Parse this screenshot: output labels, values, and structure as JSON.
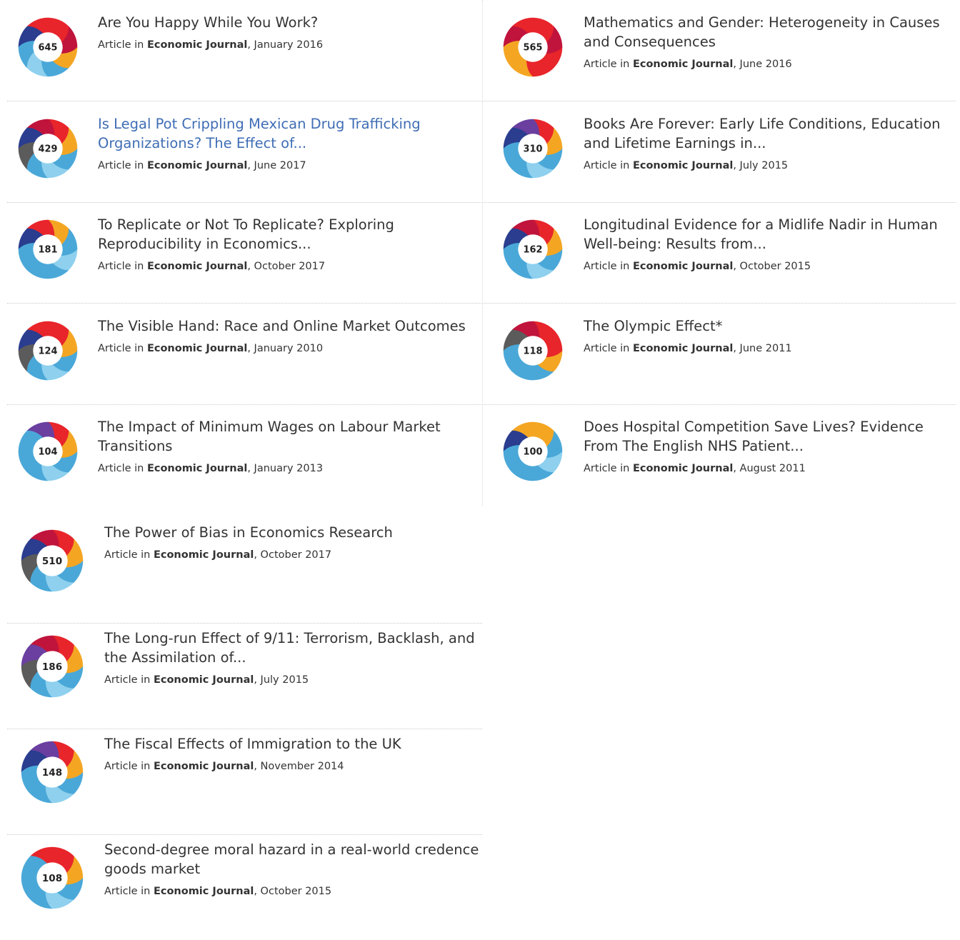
{
  "donut_colors": [
    "#e8252b",
    "#f4a623",
    "#4aa8d8",
    "#8ed0ee",
    "#2a3d8f",
    "#6a3fa0",
    "#5b5b5b",
    "#c0143c"
  ],
  "articles": [
    {
      "score": "645",
      "title": "Are You Happy While You Work?",
      "prefix": "Article in ",
      "journal": "Economic Journal",
      "date": ", January 2016",
      "link": false,
      "colors": [
        "#e8252b",
        "#c0143c",
        "#f4a623",
        "#4aa8d8",
        "#8ed0ee",
        "#4aa8d8",
        "#2a3d8f",
        "#e8252b"
      ]
    },
    {
      "score": "565",
      "title": "Mathematics and Gender: Heterogeneity in Causes and Consequences",
      "prefix": "Article in ",
      "journal": "Economic Journal",
      "date": ", June 2016",
      "link": false,
      "colors": [
        "#e8252b",
        "#c0143c",
        "#e8252b",
        "#e8252b",
        "#f4a623",
        "#f4a623",
        "#c0143c",
        "#e8252b"
      ]
    },
    {
      "score": "429",
      "title": "Is Legal Pot Crippling Mexican Drug Trafficking Organizations? The Effect of...",
      "prefix": "Article in ",
      "journal": "Economic Journal",
      "date": ", June 2017",
      "link": true,
      "colors": [
        "#e8252b",
        "#f4a623",
        "#4aa8d8",
        "#8ed0ee",
        "#4aa8d8",
        "#5b5b5b",
        "#2a3d8f",
        "#c0143c"
      ]
    },
    {
      "score": "310",
      "title": "Books Are Forever: Early Life Conditions, Education and Lifetime Earnings in...",
      "prefix": "Article in ",
      "journal": "Economic Journal",
      "date": ", July 2015",
      "link": false,
      "colors": [
        "#e8252b",
        "#f4a623",
        "#4aa8d8",
        "#8ed0ee",
        "#4aa8d8",
        "#4aa8d8",
        "#2a3d8f",
        "#6a3fa0"
      ]
    },
    {
      "score": "181",
      "title": "To Replicate or Not To Replicate? Exploring Reproducibility in Economics...",
      "prefix": "Article in ",
      "journal": "Economic Journal",
      "date": ", October 2017",
      "link": false,
      "colors": [
        "#f4a623",
        "#4aa8d8",
        "#8ed0ee",
        "#4aa8d8",
        "#4aa8d8",
        "#4aa8d8",
        "#2a3d8f",
        "#e8252b"
      ]
    },
    {
      "score": "162",
      "title": "Longitudinal Evidence for a Midlife Nadir in Human Well-being: Results from...",
      "prefix": "Article in ",
      "journal": "Economic Journal",
      "date": ", October 2015",
      "link": false,
      "colors": [
        "#e8252b",
        "#f4a623",
        "#4aa8d8",
        "#8ed0ee",
        "#4aa8d8",
        "#4aa8d8",
        "#2a3d8f",
        "#c0143c"
      ]
    },
    {
      "score": "124",
      "title": "The Visible Hand: Race and Online Market Outcomes",
      "prefix": "Article in ",
      "journal": "Economic Journal",
      "date": ", January 2010",
      "link": false,
      "colors": [
        "#e8252b",
        "#f4a623",
        "#4aa8d8",
        "#8ed0ee",
        "#4aa8d8",
        "#5b5b5b",
        "#2a3d8f",
        "#e8252b"
      ]
    },
    {
      "score": "118",
      "title": "The Olympic Effect*",
      "prefix": "Article in ",
      "journal": "Economic Journal",
      "date": ", June 2011",
      "link": false,
      "colors": [
        "#e8252b",
        "#e8252b",
        "#f4a623",
        "#4aa8d8",
        "#4aa8d8",
        "#4aa8d8",
        "#5b5b5b",
        "#c0143c"
      ]
    },
    {
      "score": "104",
      "title": "The Impact of Minimum Wages on Labour Market Transitions",
      "prefix": "Article in ",
      "journal": "Economic Journal",
      "date": ", January 2013",
      "link": false,
      "colors": [
        "#e8252b",
        "#f4a623",
        "#4aa8d8",
        "#8ed0ee",
        "#4aa8d8",
        "#4aa8d8",
        "#4aa8d8",
        "#6a3fa0"
      ]
    },
    {
      "score": "100",
      "title": "Does Hospital Competition Save Lives? Evidence From The English NHS Patient...",
      "prefix": "Article in ",
      "journal": "Economic Journal",
      "date": ", August 2011",
      "link": false,
      "colors": [
        "#f4a623",
        "#4aa8d8",
        "#8ed0ee",
        "#4aa8d8",
        "#4aa8d8",
        "#4aa8d8",
        "#2a3d8f",
        "#f4a623"
      ]
    }
  ],
  "single_articles": [
    {
      "score": "510",
      "title": "The Power of Bias in Economics Research",
      "prefix": "Article in ",
      "journal": "Economic Journal",
      "date": ", October 2017",
      "link": false,
      "colors": [
        "#e8252b",
        "#f4a623",
        "#4aa8d8",
        "#8ed0ee",
        "#4aa8d8",
        "#5b5b5b",
        "#2a3d8f",
        "#c0143c"
      ]
    },
    {
      "score": "186",
      "title": "The Long-run Effect of 9/11: Terrorism, Backlash, and the Assimilation of...",
      "prefix": "Article in ",
      "journal": "Economic Journal",
      "date": ", July 2015",
      "link": false,
      "colors": [
        "#e8252b",
        "#f4a623",
        "#4aa8d8",
        "#8ed0ee",
        "#4aa8d8",
        "#5b5b5b",
        "#6a3fa0",
        "#c0143c"
      ]
    },
    {
      "score": "148",
      "title": "The Fiscal Effects of Immigration to the UK",
      "prefix": "Article in ",
      "journal": "Economic Journal",
      "date": ", November 2014",
      "link": false,
      "colors": [
        "#e8252b",
        "#f4a623",
        "#4aa8d8",
        "#8ed0ee",
        "#4aa8d8",
        "#4aa8d8",
        "#2a3d8f",
        "#6a3fa0"
      ]
    },
    {
      "score": "108",
      "title": "Second-degree moral hazard in a real-world credence goods market",
      "prefix": "Article in ",
      "journal": "Economic Journal",
      "date": ", October 2015",
      "link": false,
      "colors": [
        "#e8252b",
        "#f4a623",
        "#4aa8d8",
        "#8ed0ee",
        "#4aa8d8",
        "#4aa8d8",
        "#4aa8d8",
        "#e8252b"
      ]
    }
  ]
}
